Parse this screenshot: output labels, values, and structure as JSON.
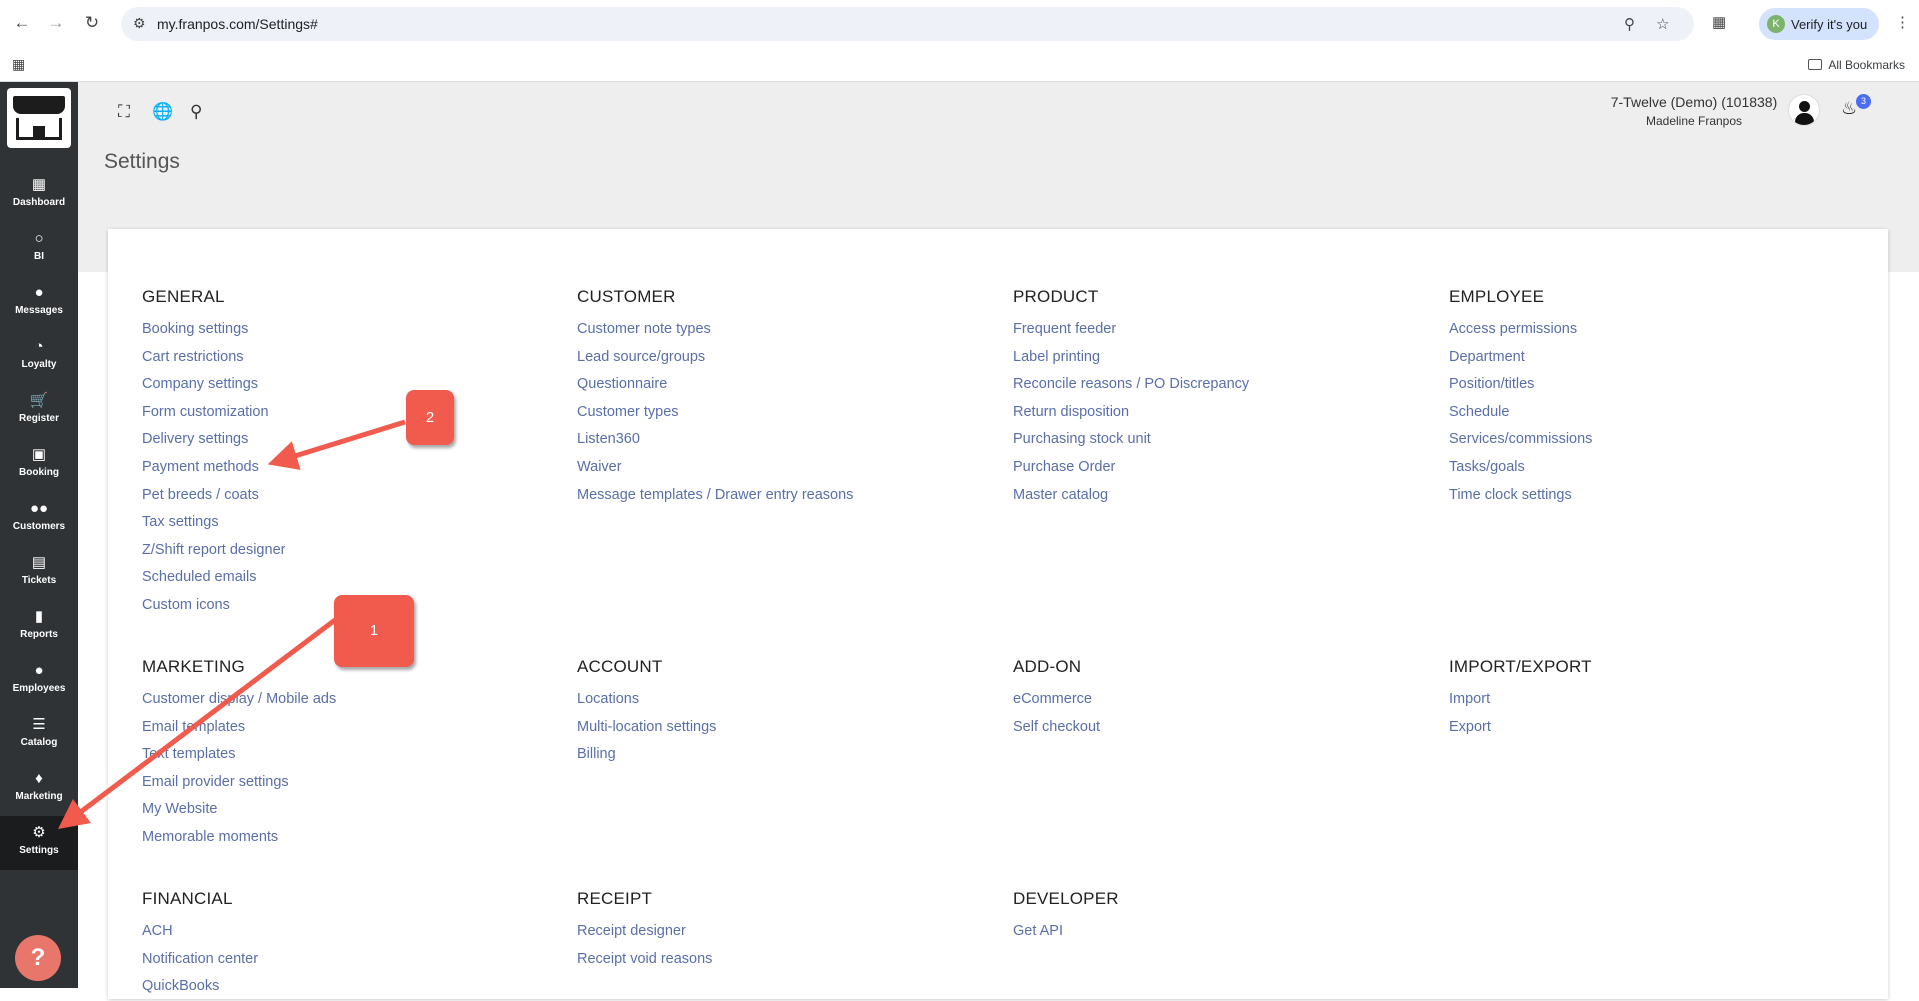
{
  "browser": {
    "url": "my.franpos.com/Settings#",
    "verify_label": "Verify it's you",
    "verify_initial": "K",
    "all_bookmarks": "All Bookmarks"
  },
  "sidebar": {
    "items": [
      {
        "label": "Dashboard",
        "icon": "dashboard-icon"
      },
      {
        "label": "BI",
        "icon": "lightbulb-icon"
      },
      {
        "label": "Messages",
        "icon": "chat-icon"
      },
      {
        "label": "Loyalty",
        "icon": "pie-icon"
      },
      {
        "label": "Register",
        "icon": "cart-icon"
      },
      {
        "label": "Booking",
        "icon": "calendar-icon"
      },
      {
        "label": "Customers",
        "icon": "people-icon"
      },
      {
        "label": "Tickets",
        "icon": "ticket-icon"
      },
      {
        "label": "Reports",
        "icon": "bar-chart-icon"
      },
      {
        "label": "Employees",
        "icon": "person-icon"
      },
      {
        "label": "Catalog",
        "icon": "list-icon"
      },
      {
        "label": "Marketing",
        "icon": "tag-icon"
      },
      {
        "label": "Settings",
        "icon": "gear-icon"
      }
    ],
    "help_label": "?"
  },
  "header": {
    "page_title": "Settings",
    "account_name": "7-Twelve (Demo) (101838)",
    "user_name": "Madeline Franpos",
    "notification_count": "3"
  },
  "sections": {
    "general": {
      "title": "GENERAL",
      "links": [
        "Booking settings",
        "Cart restrictions",
        "Company settings",
        "Form customization",
        "Delivery settings",
        "Payment methods",
        "Pet breeds / coats",
        "Tax settings",
        "Z/Shift report designer",
        "Scheduled emails",
        "Custom icons"
      ]
    },
    "customer": {
      "title": "CUSTOMER",
      "links": [
        "Customer note types",
        "Lead source/groups",
        "Questionnaire",
        "Customer types",
        "Listen360",
        "Waiver",
        "Message templates / Drawer entry reasons"
      ]
    },
    "product": {
      "title": "PRODUCT",
      "links": [
        "Frequent feeder",
        "Label printing",
        "Reconcile reasons / PO Discrepancy",
        "Return disposition",
        "Purchasing stock unit",
        "Purchase Order",
        "Master catalog"
      ]
    },
    "employee": {
      "title": "EMPLOYEE",
      "links": [
        "Access permissions",
        "Department",
        "Position/titles",
        "Schedule",
        "Services/commissions",
        "Tasks/goals",
        "Time clock settings"
      ]
    },
    "marketing": {
      "title": "MARKETING",
      "links": [
        "Customer display / Mobile ads",
        "Email templates",
        "Text templates",
        "Email provider settings",
        "My Website",
        "Memorable moments"
      ]
    },
    "account": {
      "title": "ACCOUNT",
      "links": [
        "Locations",
        "Multi-location settings",
        "Billing"
      ]
    },
    "addon": {
      "title": "ADD-ON",
      "links": [
        "eCommerce",
        "Self checkout"
      ]
    },
    "importexport": {
      "title": "IMPORT/EXPORT",
      "links": [
        "Import",
        "Export"
      ]
    },
    "financial": {
      "title": "FINANCIAL",
      "links": [
        "ACH",
        "Notification center",
        "QuickBooks"
      ]
    },
    "receipt": {
      "title": "RECEIPT",
      "links": [
        "Receipt designer",
        "Receipt void reasons"
      ]
    },
    "developer": {
      "title": "DEVELOPER",
      "links": [
        "Get API"
      ]
    }
  },
  "annotations": {
    "callout_1": "1",
    "callout_2": "2",
    "arrow_color": "#f15b4d"
  }
}
